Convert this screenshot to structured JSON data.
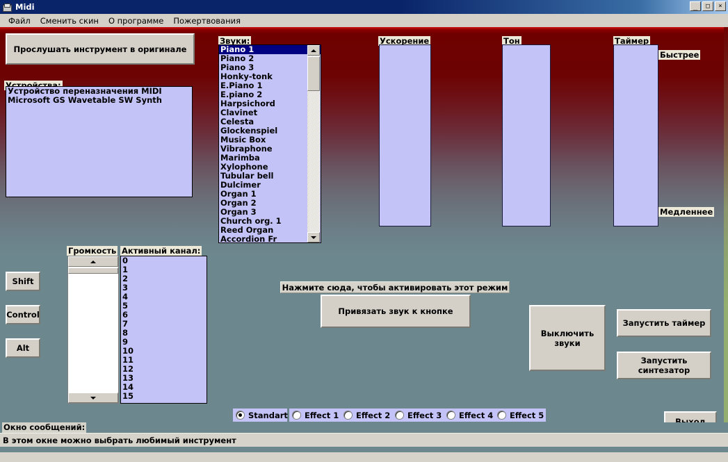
{
  "window": {
    "title": "Midi",
    "icon": "app-icon",
    "minimize": "_",
    "maximize": "□",
    "close": "×"
  },
  "menu": {
    "items": [
      {
        "label": "Файл"
      },
      {
        "label": "Сменить скин"
      },
      {
        "label": "О программе"
      },
      {
        "label": "Пожертвования"
      }
    ]
  },
  "preview": {
    "button_label": "Прослушать инструмент в оригинале"
  },
  "devices": {
    "caption": "Устройства:",
    "items": [
      "Устройство переназначения MIDI",
      "Microsoft GS Wavetable SW Synth"
    ]
  },
  "sounds": {
    "caption": "Звуки:",
    "selected_index": 0,
    "items": [
      "Piano 1",
      "Piano 2",
      "Piano 3",
      "Honky-tonk",
      "E.Piano 1",
      "E.piano 2",
      "Harpsichord",
      "Clavinet",
      "Celesta",
      "Glockenspiel",
      "Music Box",
      "Vibraphone",
      "Marimba",
      "Xylophone",
      "Tubular bell",
      "Dulcimer",
      "Organ 1",
      "Organ 2",
      "Organ 3",
      "Church org. 1",
      "Reed Organ",
      "Accordion Fr"
    ]
  },
  "acceleration": {
    "caption": "Ускорение"
  },
  "tone": {
    "caption": "Тон"
  },
  "timer": {
    "caption": "Таймер",
    "faster_label": "Быстрее",
    "slower_label": "Медленнее"
  },
  "modifiers": {
    "shift": "Shift",
    "control": "Control",
    "alt": "Alt"
  },
  "volume": {
    "caption": "Громкость"
  },
  "channels": {
    "caption": "Активный канал:",
    "items": [
      "0",
      "1",
      "2",
      "3",
      "4",
      "5",
      "6",
      "7",
      "8",
      "9",
      "10",
      "11",
      "12",
      "13",
      "14",
      "15"
    ]
  },
  "bind": {
    "hint": "Нажмите сюда, чтобы активировать этот режим",
    "button_label": "Привязать звук к кнопке"
  },
  "actions": {
    "mute": "Выключить\nзвуки",
    "start_timer": "Запустить таймер",
    "start_synth": "Запустить\nсинтезатор",
    "exit": "Выход"
  },
  "effects": {
    "selected_index": 0,
    "options": [
      {
        "label": "Standart"
      },
      {
        "label": "Effect 1"
      },
      {
        "label": "Effect 2"
      },
      {
        "label": "Effect 3"
      },
      {
        "label": "Effect 4"
      },
      {
        "label": "Effect 5"
      }
    ]
  },
  "status": {
    "caption": "Окно сообщений:",
    "message": "В этом окне можно выбрать любимый инструмент"
  },
  "colors": {
    "titlebar": "#0a246a",
    "menubar": "#d4d0c8",
    "gradient_top": "#6e0000",
    "gradient_bottom": "#6c878d",
    "listbox_bg": "#c3c3f7",
    "selection": "#000080",
    "button_face": "#d4d0c8"
  }
}
